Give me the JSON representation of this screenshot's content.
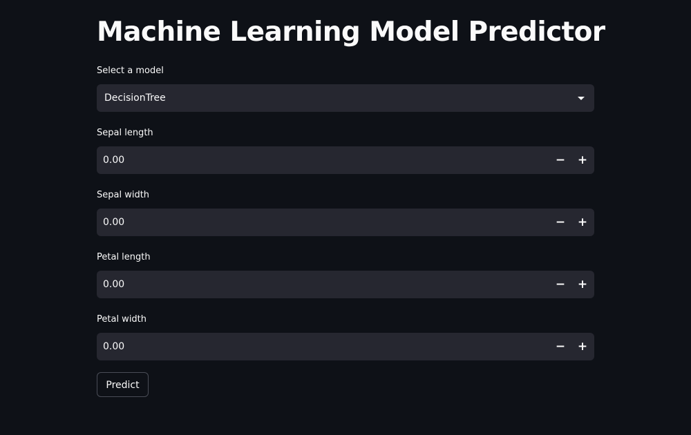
{
  "title": "Machine Learning Model Predictor",
  "model_select": {
    "label": "Select a model",
    "value": "DecisionTree",
    "icon": "chevron-down-icon"
  },
  "inputs": [
    {
      "label": "Sepal length",
      "value": "0.00"
    },
    {
      "label": "Sepal width",
      "value": "0.00"
    },
    {
      "label": "Petal length",
      "value": "0.00"
    },
    {
      "label": "Petal width",
      "value": "0.00"
    }
  ],
  "stepper": {
    "minus": "−",
    "plus": "+"
  },
  "predict_button": "Predict",
  "colors": {
    "background": "#0e1117",
    "widget": "#262730",
    "text": "#fafafa"
  }
}
